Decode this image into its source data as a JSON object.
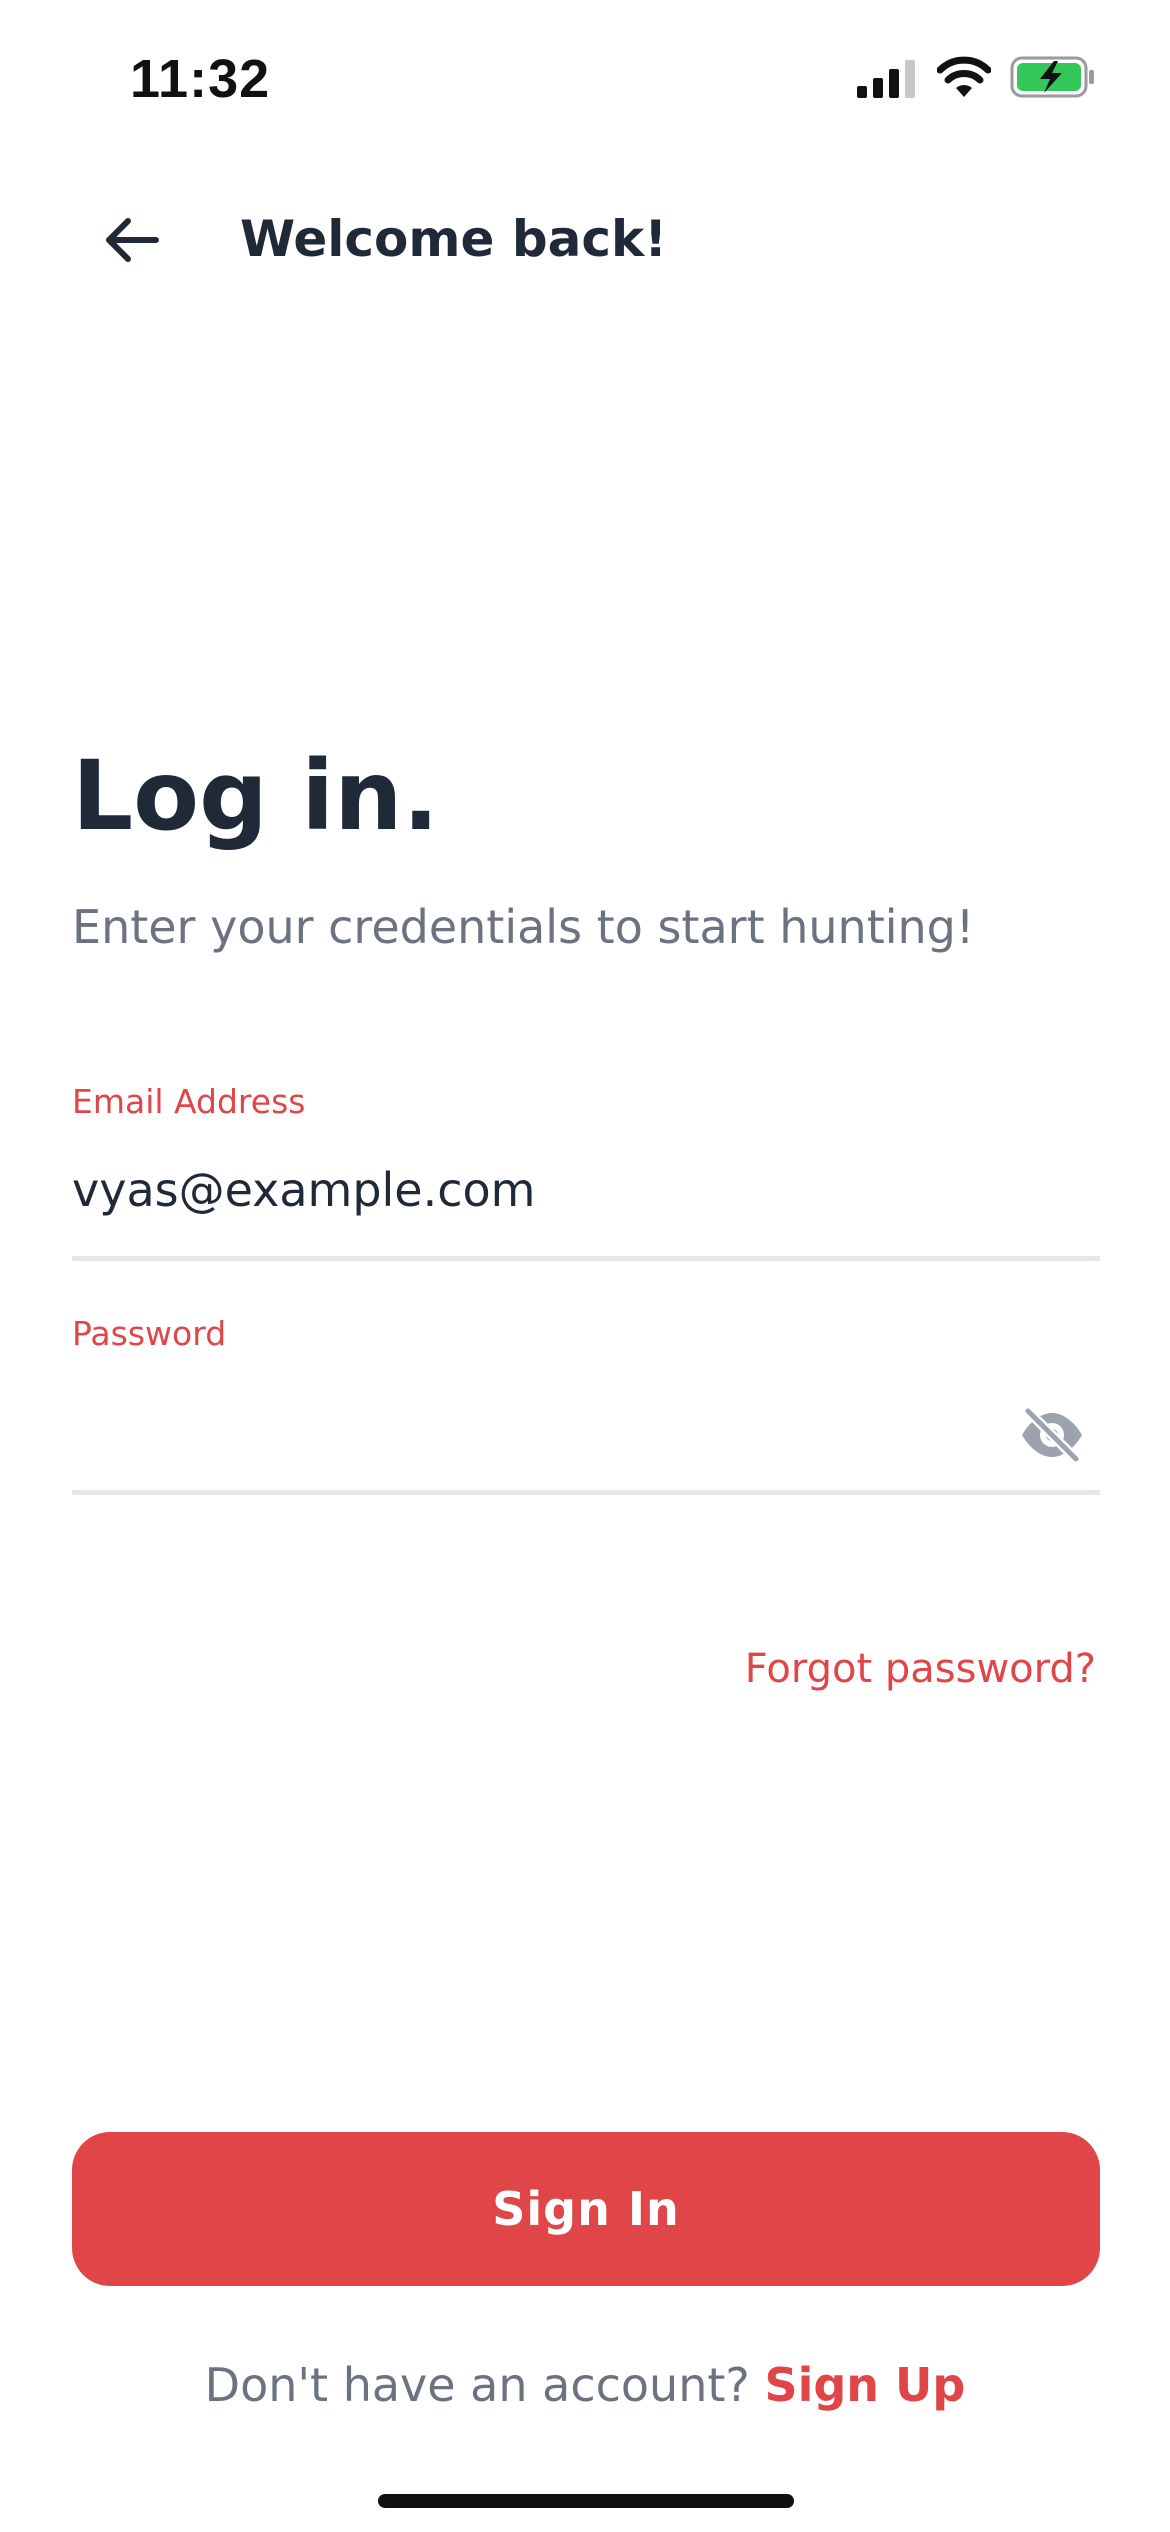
{
  "status_bar": {
    "time": "11:32",
    "icons": [
      "cellular-signal-icon",
      "wifi-icon",
      "battery-charging-icon"
    ]
  },
  "header": {
    "back_icon": "arrow-left-icon",
    "title": "Welcome back!"
  },
  "main": {
    "heading": "Log in.",
    "subheading": "Enter your credentials to start hunting!"
  },
  "form": {
    "email": {
      "label": "Email Address",
      "value": "vyas@example.com"
    },
    "password": {
      "label": "Password",
      "value": "",
      "toggle_icon": "eye-off-icon"
    },
    "forgot_password": "Forgot password?",
    "submit_label": "Sign In"
  },
  "footer": {
    "prompt": "Don't have an account?",
    "signup_label": "Sign Up"
  },
  "colors": {
    "accent": "#e04648",
    "text_primary": "#1f2937",
    "text_secondary": "#6b7280",
    "divider": "#e5e7eb",
    "battery_fill": "#34c759"
  }
}
